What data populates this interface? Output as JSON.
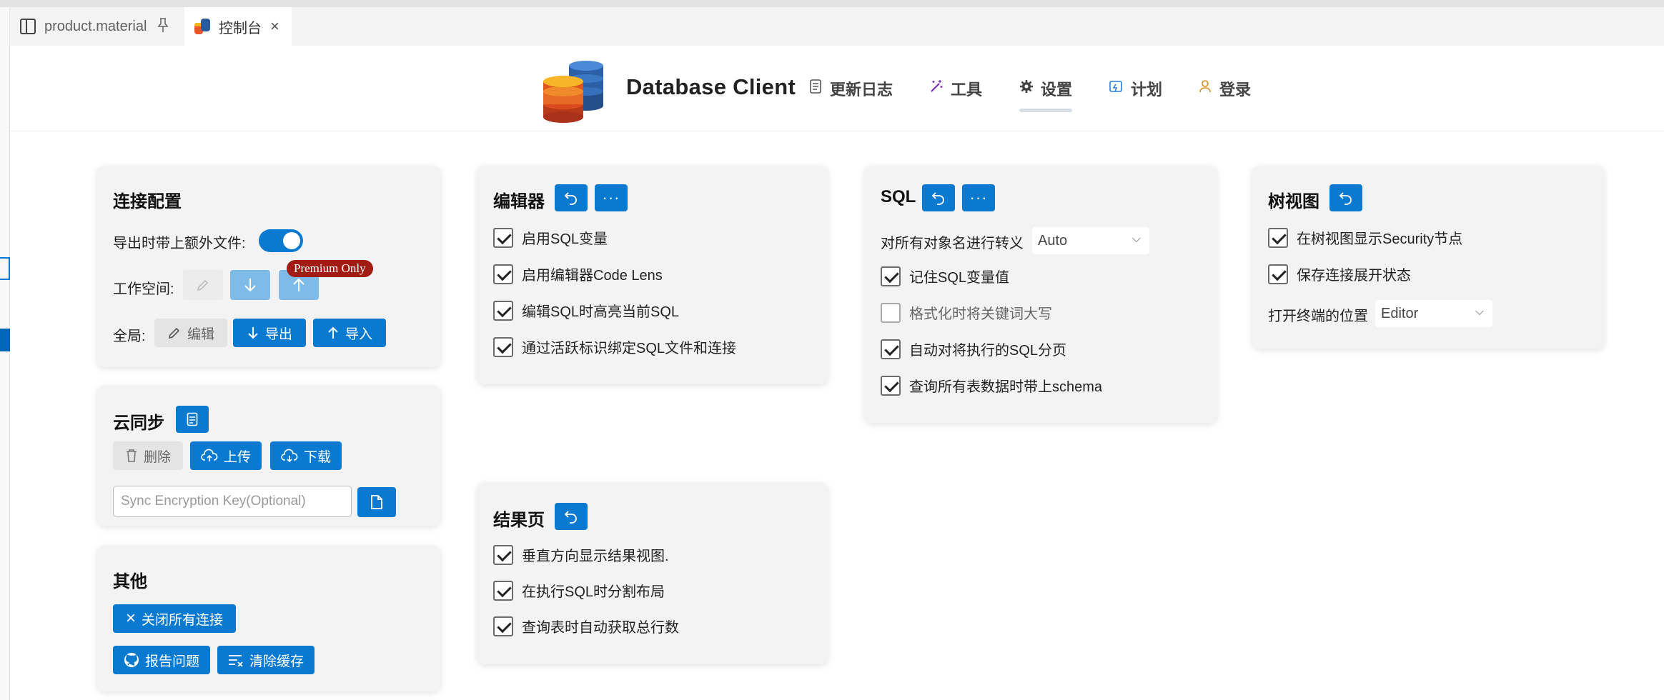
{
  "tabs": [
    {
      "label": "product.material",
      "icon": "layout-icon",
      "pinned": true
    },
    {
      "label": "控制台",
      "icon": "database-icon",
      "closable": true
    }
  ],
  "header": {
    "brand": "Database Client",
    "nav": [
      {
        "label": "更新日志",
        "icon": "changelog-icon"
      },
      {
        "label": "工具",
        "icon": "magic-wand-icon"
      },
      {
        "label": "设置",
        "icon": "gear-icon",
        "active": true
      },
      {
        "label": "计划",
        "icon": "plan-icon"
      },
      {
        "label": "登录",
        "icon": "user-icon"
      }
    ]
  },
  "connection": {
    "title": "连接配置",
    "export_extra_label": "导出时带上额外文件:",
    "export_extra_on": true,
    "workspace_label": "工作空间:",
    "premium_badge": "Premium Only",
    "global_label": "全局:",
    "edit_label": "编辑",
    "export_label": "导出",
    "import_label": "导入"
  },
  "cloud_sync": {
    "title": "云同步",
    "delete_label": "删除",
    "upload_label": "上传",
    "download_label": "下载",
    "key_placeholder": "Sync Encryption Key(Optional)"
  },
  "other": {
    "title": "其他",
    "close_all_label": "关闭所有连接",
    "report_label": "报告问题",
    "clear_cache_label": "清除缓存"
  },
  "editor": {
    "title": "编辑器",
    "items": [
      {
        "label": "启用SQL变量",
        "checked": true
      },
      {
        "label": "启用编辑器Code Lens",
        "checked": true
      },
      {
        "label": "编辑SQL时高亮当前SQL",
        "checked": true
      },
      {
        "label": "通过活跃标识绑定SQL文件和连接",
        "checked": true
      }
    ]
  },
  "result": {
    "title": "结果页",
    "items": [
      {
        "label": "垂直方向显示结果视图.",
        "checked": true
      },
      {
        "label": "在执行SQL时分割布局",
        "checked": true
      },
      {
        "label": "查询表时自动获取总行数",
        "checked": true
      }
    ]
  },
  "sql": {
    "title": "SQL",
    "escape_label": "对所有对象名进行转义",
    "escape_value": "Auto",
    "items": [
      {
        "label": "记住SQL变量值",
        "checked": true
      },
      {
        "label": "格式化时将关键词大写",
        "checked": false
      },
      {
        "label": "自动对将执行的SQL分页",
        "checked": true
      },
      {
        "label": "查询所有表数据时带上schema",
        "checked": true
      }
    ]
  },
  "tree": {
    "title": "树视图",
    "items": [
      {
        "label": "在树视图显示Security节点",
        "checked": true
      },
      {
        "label": "保存连接展开状态",
        "checked": true
      }
    ],
    "terminal_label": "打开终端的位置",
    "terminal_value": "Editor"
  },
  "colors": {
    "accent": "#0a7ad0",
    "premium": "#a11d14",
    "card_bg": "#f3f3f3"
  }
}
